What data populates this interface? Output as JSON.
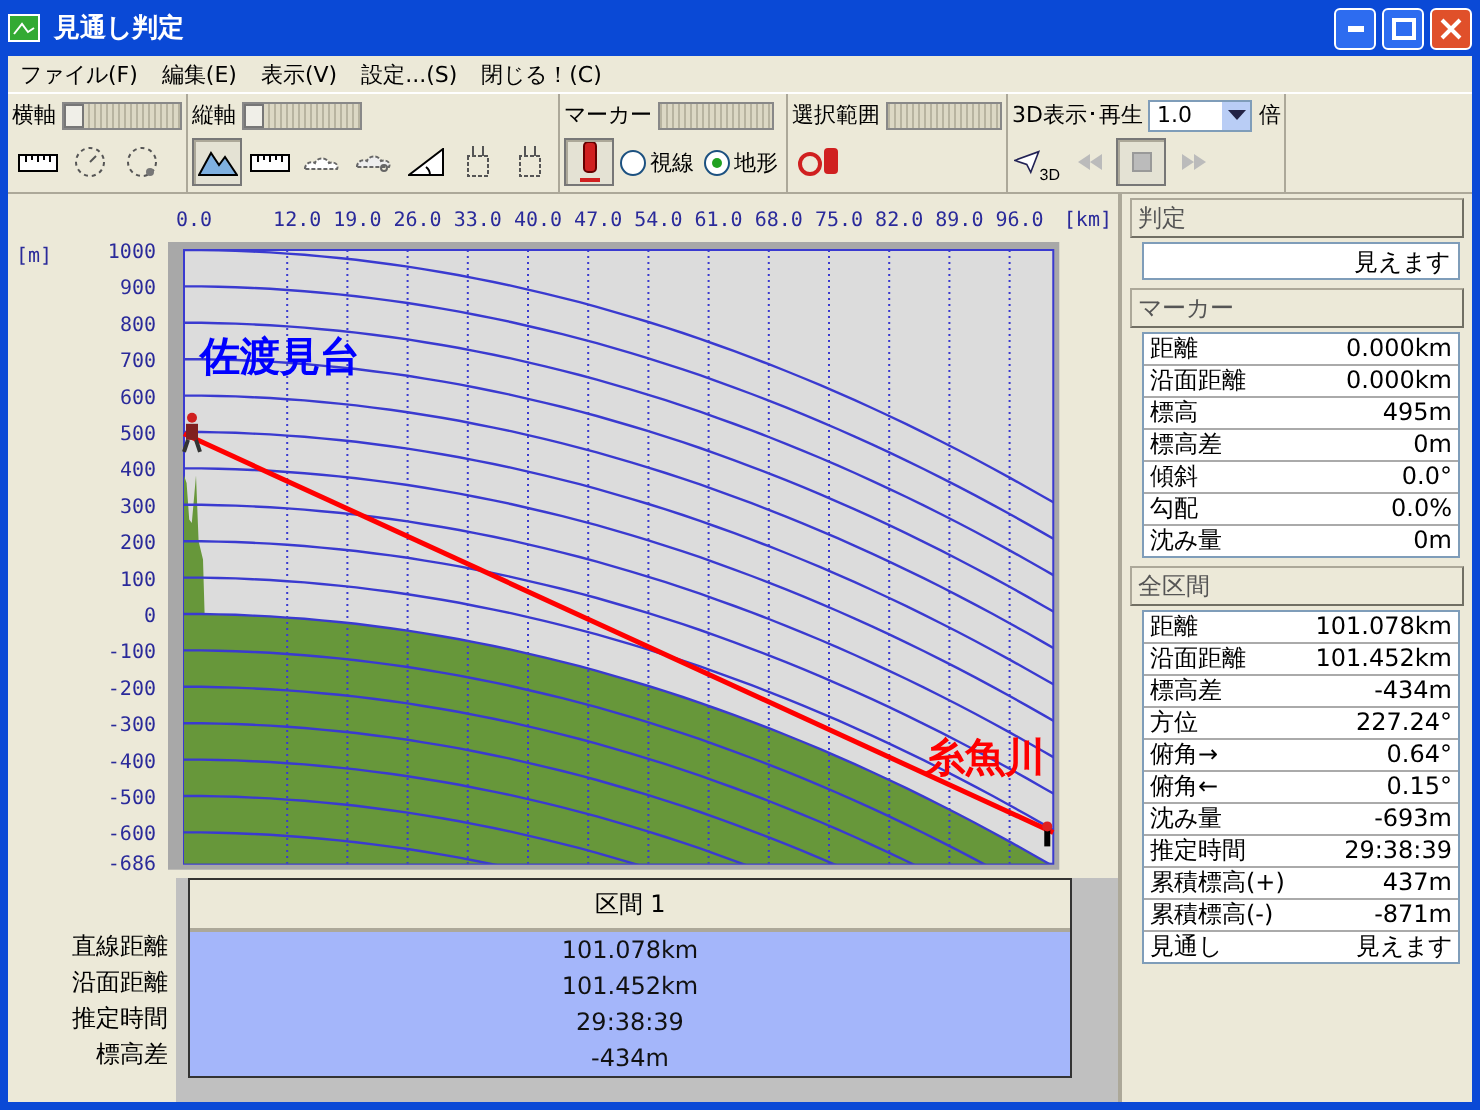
{
  "window": {
    "title": "見通し判定"
  },
  "menu": [
    "ファイル(F)",
    "編集(E)",
    "表示(V)",
    "設定...(S)",
    "閉じる！(C)"
  ],
  "toolbar": {
    "groups": [
      {
        "kind": "axis",
        "label": "横軸",
        "slider": {
          "level": 0
        },
        "buttons": [
          {
            "pressed": false
          },
          {
            "pressed": false
          },
          {
            "pressed": false
          }
        ]
      },
      {
        "kind": "axis",
        "label": "縦軸",
        "slider": {
          "level": 0
        },
        "buttons": [
          {
            "pressed": true
          },
          {
            "pressed": false
          },
          {
            "pressed": false
          },
          {
            "pressed": false
          },
          {
            "pressed": false
          },
          {
            "pressed": false
          },
          {
            "pressed": false
          }
        ]
      },
      {
        "kind": "marker",
        "label": "マーカー",
        "buttons": [
          {
            "pressed": true
          }
        ],
        "radios": [
          {
            "label": "視線",
            "selected": false
          },
          {
            "label": "地形",
            "selected": true
          }
        ]
      },
      {
        "kind": "range",
        "label": "選択範囲",
        "buttons": [
          {
            "pressed": false
          }
        ]
      },
      {
        "kind": "play",
        "label": "3D表示･再生",
        "speed": "1.0",
        "unit": "倍",
        "buttons": [
          {
            "pressed": false,
            "badge": "3D"
          },
          {
            "pressed": false
          },
          {
            "pressed": true
          },
          {
            "pressed": false
          }
        ]
      }
    ]
  },
  "profile": {
    "x_unit": "[km]",
    "y_unit": "[m]",
    "x_labels": [
      "0.0",
      "12.0",
      "19.0",
      "26.0",
      "33.0",
      "40.0",
      "47.0",
      "54.0",
      "61.0",
      "68.0",
      "75.0",
      "82.0",
      "89.0",
      "96.0"
    ],
    "y_labels": [
      "1000",
      "900",
      "800",
      "700",
      "600",
      "500",
      "400",
      "300",
      "200",
      "100",
      "0",
      "-100",
      "-200",
      "-300",
      "-400",
      "-500",
      "-600",
      "-686"
    ],
    "place_labels": [
      {
        "text": "佐渡見台",
        "kind": "start"
      },
      {
        "text": "糸魚川",
        "kind": "end"
      }
    ]
  },
  "section_table": {
    "header": "区間 1",
    "rows": [
      {
        "label": "直線距離",
        "value": "101.078km"
      },
      {
        "label": "沿面距離",
        "value": "101.452km"
      },
      {
        "label": "推定時間",
        "value": "29:38:39"
      },
      {
        "label": "標高差",
        "value": "-434m"
      }
    ]
  },
  "side_panel": {
    "judgement": {
      "title": "判定",
      "value": "見えます"
    },
    "marker": {
      "title": "マーカー",
      "rows": [
        {
          "label": "距離",
          "value": "0.000km"
        },
        {
          "label": "沿面距離",
          "value": "0.000km"
        },
        {
          "label": "標高",
          "value": "495m"
        },
        {
          "label": "標高差",
          "value": "0m"
        },
        {
          "label": "傾斜",
          "value": "0.0°"
        },
        {
          "label": "勾配",
          "value": "0.0%"
        },
        {
          "label": "沈み量",
          "value": "0m"
        }
      ]
    },
    "total": {
      "title": "全区間",
      "rows": [
        {
          "label": "距離",
          "value": "101.078km"
        },
        {
          "label": "沿面距離",
          "value": "101.452km"
        },
        {
          "label": "標高差",
          "value": "-434m"
        },
        {
          "label": "方位",
          "value": "227.24°"
        },
        {
          "label": "俯角→",
          "value": "0.64°"
        },
        {
          "label": "俯角←",
          "value": "0.15°"
        },
        {
          "label": "沈み量",
          "value": "-693m"
        },
        {
          "label": "推定時間",
          "value": "29:38:39"
        },
        {
          "label": "累積標高(+)",
          "value": "437m"
        },
        {
          "label": "累積標高(-)",
          "value": "-871m"
        },
        {
          "label": "見通し",
          "value": "見えます"
        }
      ]
    }
  }
}
